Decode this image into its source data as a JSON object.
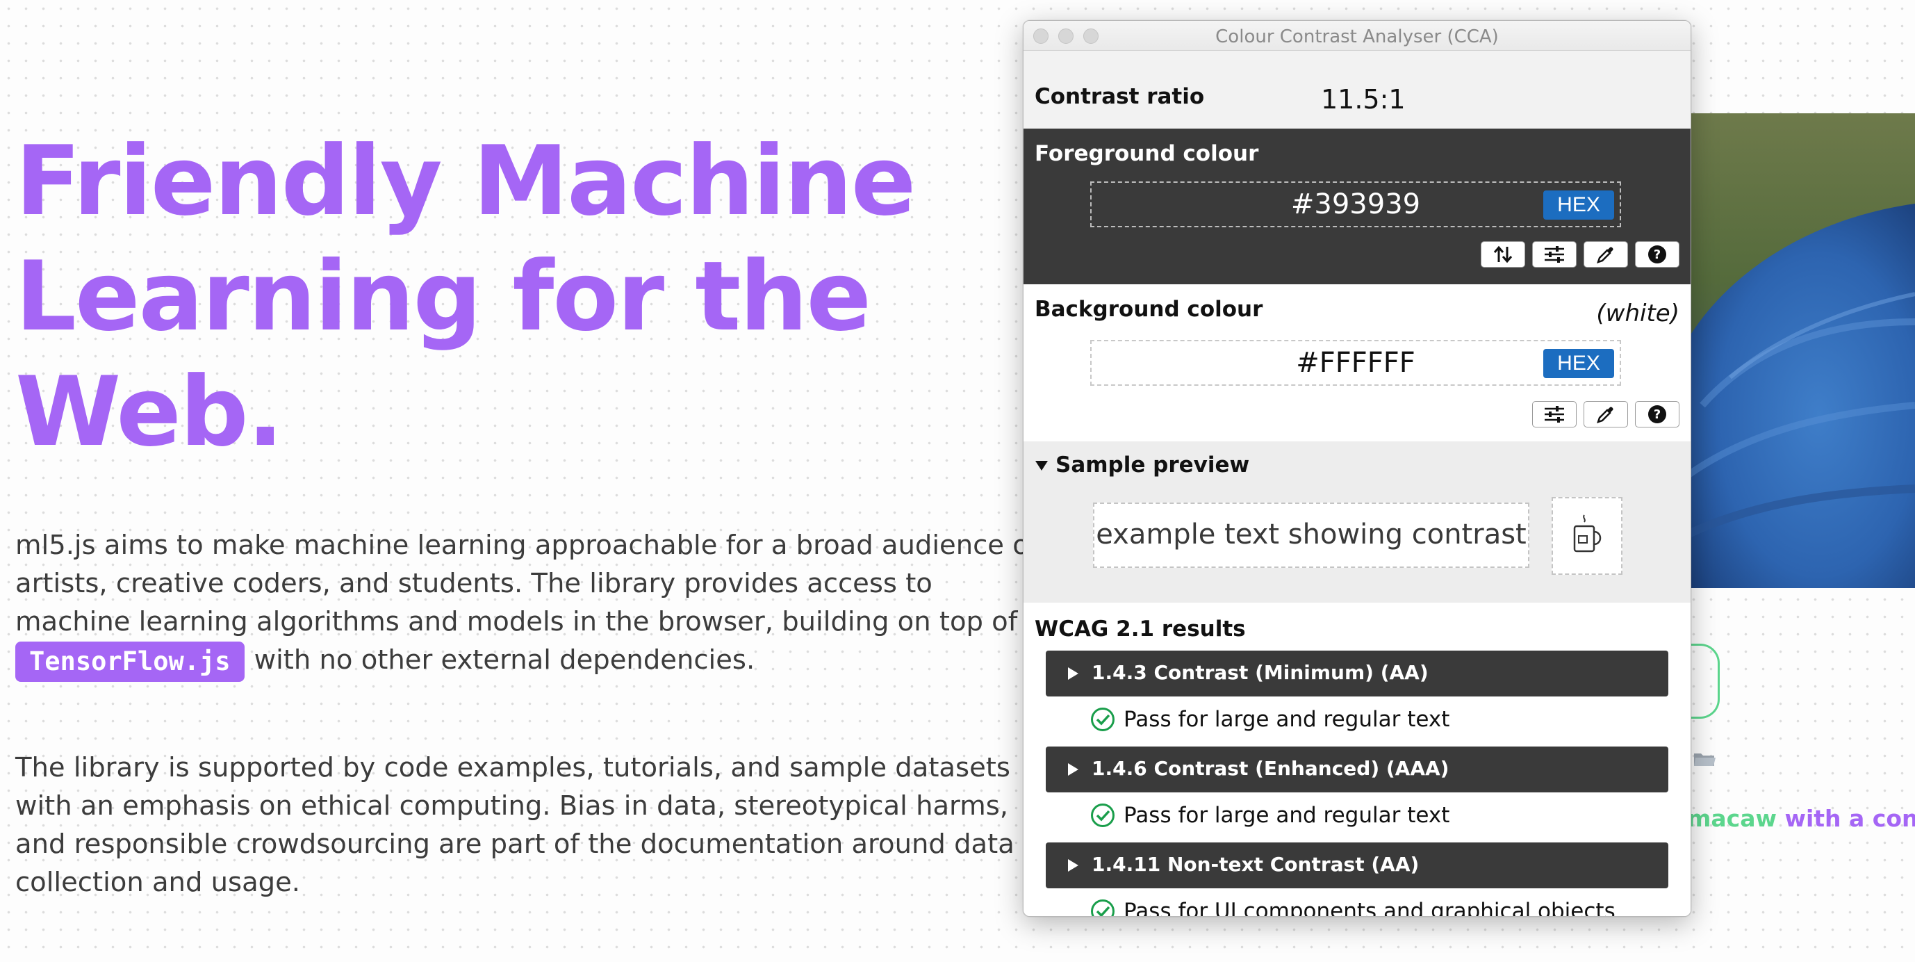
{
  "page": {
    "hero_title_lines": [
      "Friendly Machine",
      "Learning for the",
      "Web."
    ],
    "para1": {
      "line1": "ml5.js aims to make machine learning approachable for a broad audience of",
      "line2": "artists, creative coders, and students. The library provides access to",
      "line3": "machine learning algorithms and models in the browser, building on top of",
      "badge": "TensorFlow.js",
      "line4_rest": "with no other external dependencies."
    },
    "para2": {
      "lines": [
        "The library is supported by code examples, tutorials, and sample datasets",
        "with an emphasis on ethical computing. Bias in data, stereotypical harms,",
        "and responsible crowdsourcing are part of the documentation around data",
        "collection and usage."
      ]
    },
    "right_caption": {
      "part1": "macaw",
      "part2": " with a confide"
    },
    "accent_color": "#a566f5",
    "green_color": "#5cd68d"
  },
  "cca": {
    "window_title": "Colour Contrast Analyser (CCA)",
    "contrast_ratio_label": "Contrast ratio",
    "contrast_ratio_value": "11.5:1",
    "foreground": {
      "label": "Foreground colour",
      "hex": "#393939",
      "format_button": "HEX"
    },
    "background": {
      "label": "Background colour",
      "name_hint": "(white)",
      "hex": "#FFFFFF",
      "format_button": "HEX"
    },
    "sample": {
      "label": "Sample preview",
      "text": "example text showing contrast"
    },
    "wcag": {
      "label": "WCAG 2.1 results",
      "criteria": [
        {
          "title": "1.4.3 Contrast (Minimum) (AA)",
          "result": "Pass for large and regular text"
        },
        {
          "title": "1.4.6 Contrast (Enhanced) (AAA)",
          "result": "Pass for large and regular text"
        },
        {
          "title": "1.4.11 Non-text Contrast (AA)",
          "result": "Pass for UI components and graphical objects"
        }
      ]
    },
    "icons": [
      "swap-icon",
      "sliders-icon",
      "eyedropper-icon",
      "help-icon",
      "mug-icon",
      "check-circle-icon"
    ]
  }
}
